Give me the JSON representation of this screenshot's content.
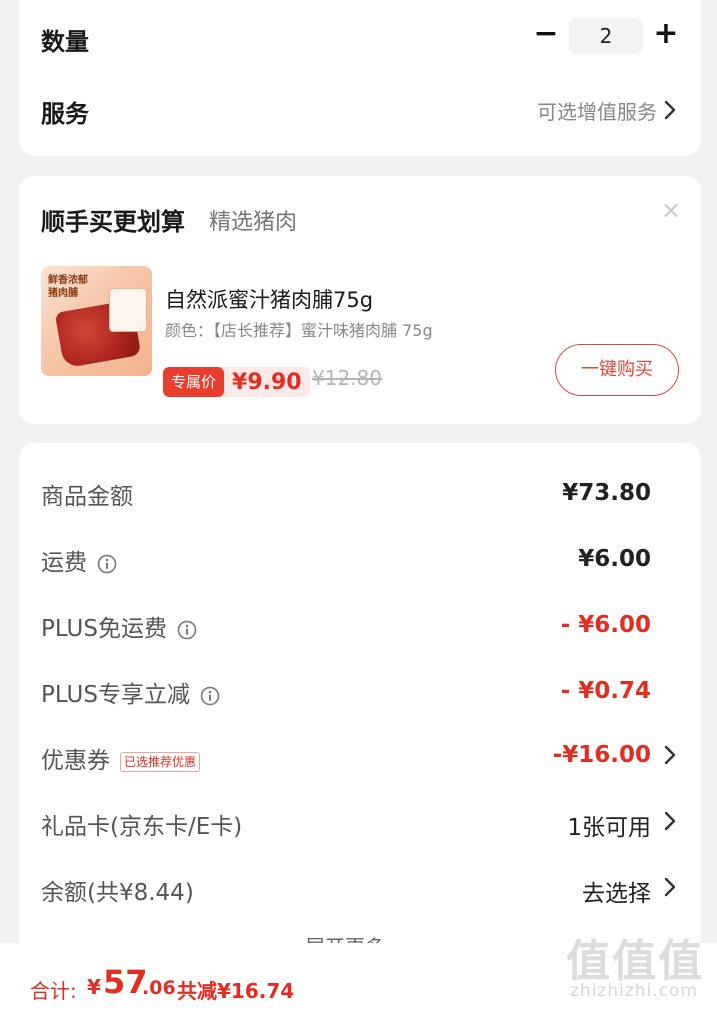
{
  "quantity": {
    "label": "数量",
    "minus": "−",
    "value": "2",
    "plus": "+"
  },
  "service": {
    "label": "服务",
    "value": "可选增值服务"
  },
  "upsell": {
    "title": "顺手买更划算",
    "subtitle": "精选猪肉",
    "close": "×",
    "product": {
      "image_text_1": "鲜香浓郁",
      "image_text_2": "猪肉脯",
      "name": "自然派蜜汁猪肉脯75g",
      "spec": "颜色：【店长推荐】蜜汁味猪肉脯 75g",
      "promo_label": "专属价",
      "promo_price": "¥9.90",
      "original_price": "¥12.80",
      "buy_button": "一键购买"
    }
  },
  "prices": {
    "goods": {
      "label": "商品金额",
      "value": "¥73.80"
    },
    "shipping": {
      "label": "运费",
      "value": "¥6.00"
    },
    "plus_free_shipping": {
      "label": "PLUS免运费",
      "value": "- ¥6.00"
    },
    "plus_discount": {
      "label": "PLUS专享立减",
      "value": "- ¥0.74"
    },
    "coupon": {
      "label": "优惠券",
      "badge": "已选推荐优惠",
      "value": "-¥16.00"
    },
    "gift_card": {
      "label": "礼品卡(京东卡/E卡)",
      "value": "1张可用"
    },
    "balance": {
      "label": "余额(共¥8.44)",
      "value": "去选择"
    },
    "expand_more": "展开更多"
  },
  "bottom": {
    "total_label": "合计:",
    "currency": "¥",
    "total_int": "57",
    "total_dec": ".06",
    "saved": "共减¥16.74"
  },
  "watermark": {
    "glyphs": "值值值",
    "site": "zhizhizhi.com"
  },
  "colors": {
    "accent_red": "#e42d1f",
    "card_bg": "#ffffff",
    "page_bg": "#f2f2f2"
  }
}
